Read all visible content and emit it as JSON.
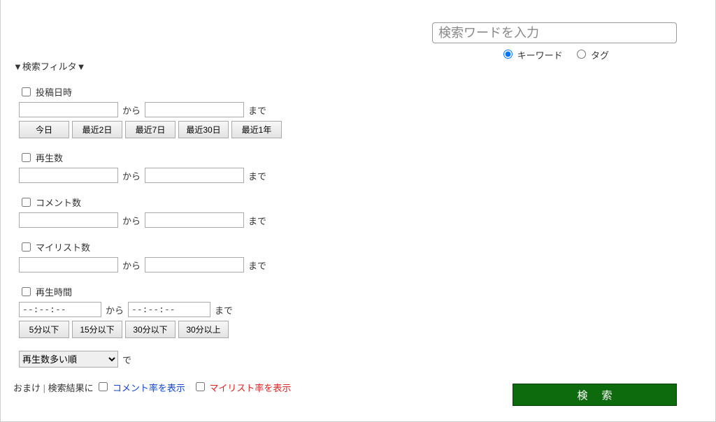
{
  "search": {
    "placeholder": "検索ワードを入力",
    "radio_keyword": "キーワード",
    "radio_tag": "タグ"
  },
  "filter": {
    "title": "▼検索フィルタ▼",
    "from": "から",
    "to": "まで",
    "post_date": {
      "label": "投稿日時",
      "quick": [
        "今日",
        "最近2日",
        "最近7日",
        "最近30日",
        "最近1年"
      ]
    },
    "plays": {
      "label": "再生数"
    },
    "comments": {
      "label": "コメント数"
    },
    "mylists": {
      "label": "マイリスト数"
    },
    "duration": {
      "label": "再生時間",
      "placeholder": "--:--:--",
      "quick": [
        "5分以下",
        "15分以下",
        "30分以下",
        "30分以上"
      ]
    },
    "sort": {
      "selected": "再生数多い順",
      "suffix": "で"
    },
    "extra": {
      "prefix": "おまけ",
      "divider": "|",
      "results_in": "検索結果に",
      "comment_rate": "コメント率を表示",
      "mylist_rate": "マイリスト率を表示"
    }
  },
  "button": {
    "search": "検索"
  }
}
